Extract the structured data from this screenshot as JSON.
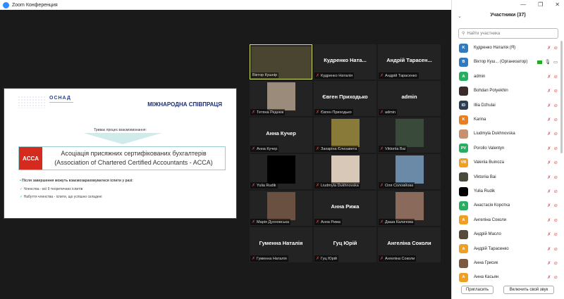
{
  "window": {
    "title": "Zoom Конференция"
  },
  "slide": {
    "logo": "ОСНАД",
    "title": "МІЖНАРОДНА СПІВПРАЦЯ",
    "process": "Триває процес взаємовизнання:",
    "acca_logo": "ACCA",
    "acca_line1": "Асоціація присяжних сертифікованих бухгалтерів",
    "acca_line2": "(Association of Chartered Certified Accountants - ACCA)",
    "bullets": [
      "Після завершення можуть взаємозараховуватися іспити у разі:",
      "Членства - всі 9 теоретичних іспитів",
      "Набуття членства - іспити, що успішно складені"
    ]
  },
  "tiles": [
    {
      "name": "Віктор Кушнір",
      "big": "",
      "photo": "#4a4530",
      "active": true,
      "muted": false
    },
    {
      "name": "Кудренко Наталія",
      "big": "Кудренко Ната...",
      "photo": "",
      "muted": true
    },
    {
      "name": "Андрій Тарасенко",
      "big": "Андрій Тарасен...",
      "photo": "",
      "muted": true
    },
    {
      "name": "Тетяна Реднюк",
      "big": "",
      "photo": "#9a8b7a",
      "muted": true
    },
    {
      "name": "Євген Приходько",
      "big": "Євген Приходько",
      "photo": "",
      "muted": true
    },
    {
      "name": "admin",
      "big": "admin",
      "photo": "",
      "muted": true
    },
    {
      "name": "Анна Кучер",
      "big": "Анна Кучер",
      "photo": "",
      "muted": true
    },
    {
      "name": "Захаріна Єлизавета",
      "big": "",
      "photo": "#8a7a3a",
      "muted": true
    },
    {
      "name": "Viktoriia Bai",
      "big": "",
      "photo": "#3a4a3a",
      "muted": true
    },
    {
      "name": "Yulia Rudik",
      "big": "",
      "photo": "#000000",
      "muted": true
    },
    {
      "name": "Liudmyla Dukhnovska",
      "big": "",
      "photo": "#d8c8b8",
      "muted": true
    },
    {
      "name": "Оля Соловйова",
      "big": "",
      "photo": "#6a8aa8",
      "muted": true
    },
    {
      "name": "Марія Духновська",
      "big": "",
      "photo": "#6a5040",
      "muted": true
    },
    {
      "name": "Анна Рижа",
      "big": "Анна Рижа",
      "photo": "",
      "muted": true
    },
    {
      "name": "Даша Калачова",
      "big": "",
      "photo": "#8a6a5a",
      "muted": true
    },
    {
      "name": "Гуменна Наталія",
      "big": "Гуменна Наталія",
      "photo": "",
      "muted": true
    },
    {
      "name": "Гуц Юрій",
      "big": "Гуц Юрій",
      "photo": "",
      "muted": true
    },
    {
      "name": "Ангеліна Соколи",
      "big": "Ангеліна Соколи",
      "photo": "",
      "muted": true
    }
  ],
  "panel": {
    "title": "Участники (37)",
    "search_placeholder": "Найти участника",
    "invite": "Пригласить",
    "unmute_self": "Включить свой звук",
    "participants": [
      {
        "initials": "K",
        "name": "Кудренко Наталія (Я)",
        "color": "#2e7bc4"
      },
      {
        "initials": "B",
        "name": "Віктор Куш... (Организатор)",
        "color": "#2e7bc4",
        "host": true
      },
      {
        "initials": "A",
        "name": "admin",
        "color": "#27ae60"
      },
      {
        "initials": "",
        "name": "Bohdan Potyekhin",
        "color": "#3a2a2a"
      },
      {
        "initials": "ID",
        "name": "Illia Dzhulai",
        "color": "#2c3e50"
      },
      {
        "initials": "K",
        "name": "Karina",
        "color": "#e67e22"
      },
      {
        "initials": "",
        "name": "Liudmyla Dukhnovska",
        "color": "#c89070"
      },
      {
        "initials": "PV",
        "name": "Porollo Valentyn",
        "color": "#27ae60"
      },
      {
        "initials": "VB",
        "name": "Valeriia Buinoza",
        "color": "#f0a020"
      },
      {
        "initials": "",
        "name": "Viktoriia Bai",
        "color": "#4a4a3a"
      },
      {
        "initials": "",
        "name": "Yulia Rudik",
        "color": "#000000"
      },
      {
        "initials": "A",
        "name": "Анастасія Коротка",
        "color": "#27ae60"
      },
      {
        "initials": "A",
        "name": "Ангеліна Соколи",
        "color": "#f0a020"
      },
      {
        "initials": "",
        "name": "Андрій Масло",
        "color": "#5a4a3a"
      },
      {
        "initials": "A",
        "name": "Андрій Тарасенко",
        "color": "#f0a020"
      },
      {
        "initials": "",
        "name": "Анна Грисик",
        "color": "#7a5a40"
      },
      {
        "initials": "A",
        "name": "Анна Касьян",
        "color": "#f0a020"
      }
    ]
  }
}
